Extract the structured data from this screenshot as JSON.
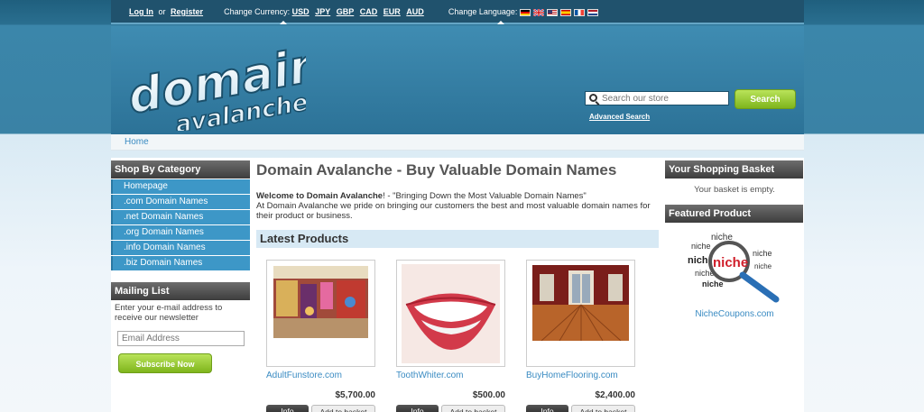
{
  "topbar": {
    "login": "Log In",
    "or": "or",
    "register": "Register",
    "currency_label": "Change Currency:",
    "currencies": [
      "USD",
      "JPY",
      "GBP",
      "CAD",
      "EUR",
      "AUD"
    ],
    "language_label": "Change Language:",
    "languages": [
      "german-flag-icon",
      "uk-flag-icon",
      "us-flag-icon",
      "spanish-flag-icon",
      "french-flag-icon",
      "dutch-flag-icon"
    ]
  },
  "header": {
    "logo_text_main": "domain",
    "logo_text_sub": "avalanche",
    "search_placeholder": "Search our store",
    "search_button": "Search",
    "advanced_search": "Advanced Search"
  },
  "breadcrumb": {
    "home": "Home"
  },
  "left": {
    "category_title": "Shop By Category",
    "categories": [
      "Homepage",
      ".com Domain Names",
      ".net Domain Names",
      ".org Domain Names",
      ".info Domain Names",
      ".biz Domain Names"
    ],
    "mailing_title": "Mailing List",
    "mailing_text": "Enter your e-mail address to receive our newsletter",
    "email_placeholder": "Email Address",
    "subscribe": "Subscribe Now"
  },
  "main": {
    "title": "Domain Avalanche - Buy Valuable Domain Names",
    "welcome_bold": "Welcome to Domain Avalanche",
    "welcome_rest": "! - \"Bringing Down the Most Valuable Domain Names\"",
    "welcome_body": "At Domain Avalanche we pride on bringing our customers the best and most valuable domain names for their product or business.",
    "latest_title": "Latest Products",
    "products": [
      {
        "name": "AdultFunstore.com",
        "price": "$5,700.00",
        "info": "Info",
        "basket": "Add to basket"
      },
      {
        "name": "ToothWhiter.com",
        "price": "$500.00",
        "info": "Info",
        "basket": "Add to basket"
      },
      {
        "name": "BuyHomeFlooring.com",
        "price": "$2,400.00",
        "info": "Info",
        "basket": "Add to basket"
      }
    ]
  },
  "right": {
    "basket_title": "Your Shopping Basket",
    "basket_empty": "Your basket is empty.",
    "featured_title": "Featured Product",
    "featured_link": "NicheCoupons.com",
    "featured_words": [
      "niche",
      "niche",
      "niche",
      "niche",
      "niche",
      "niche",
      "niche",
      "niche"
    ]
  }
}
